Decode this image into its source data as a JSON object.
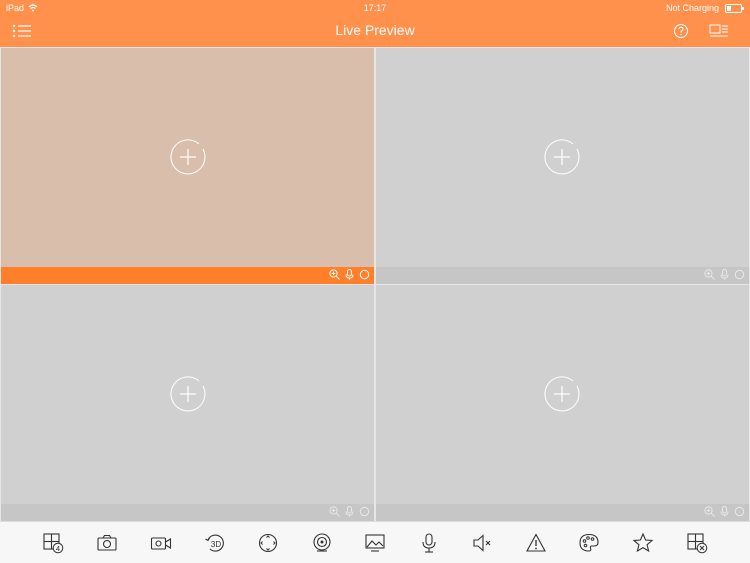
{
  "status_bar": {
    "device": "iPad",
    "time": "17:17",
    "charging": "Not Charging"
  },
  "nav": {
    "title": "Live Preview",
    "left_icon": "list-menu-icon",
    "right_icons": [
      "help-icon",
      "device-list-icon"
    ]
  },
  "colors": {
    "accent": "#ff914d",
    "selected_bar": "#ff7f2a",
    "selected_pane": "#d9bfab",
    "pane": "#d0d0d0",
    "pane_bar": "#c6c6c6"
  },
  "panes": [
    {
      "selected": true,
      "icons": [
        "zoom-icon",
        "microphone-icon",
        "record-indicator-icon"
      ]
    },
    {
      "selected": false,
      "icons": [
        "zoom-icon",
        "microphone-icon",
        "record-indicator-icon"
      ]
    },
    {
      "selected": false,
      "icons": [
        "zoom-icon",
        "microphone-icon",
        "record-indicator-icon"
      ]
    },
    {
      "selected": false,
      "icons": [
        "zoom-icon",
        "microphone-icon",
        "record-indicator-icon"
      ]
    }
  ],
  "toolbar": {
    "icons": [
      "window-split-icon",
      "camera-icon",
      "video-record-icon",
      "3d-rotate-icon",
      "ptz-icon",
      "ezoom-icon",
      "image-icon",
      "microphone-icon",
      "speaker-mute-icon",
      "alarm-icon",
      "palette-icon",
      "favorite-star-icon",
      "close-all-icon"
    ],
    "split_badge": "4"
  }
}
